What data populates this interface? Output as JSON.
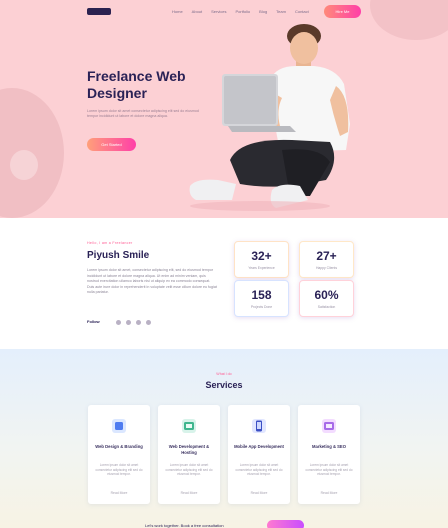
{
  "header": {
    "nav_items": [
      "Home",
      "About",
      "Services",
      "Portfolio",
      "Blog",
      "Team",
      "Contact"
    ],
    "hire_button": "Hire Me"
  },
  "hero": {
    "title": "Freelance Web Designer",
    "description": "Lorem ipsum dolor sit amet consectetur adipiscing elit sed do eiusmod tempor incididunt ut labore et dolore magna aliqua.",
    "button": "Get Started"
  },
  "about": {
    "kicker": "Hello, I am a Freelancer",
    "name": "Piyush Smile",
    "text": "Lorem ipsum dolor sit amet, consectetur adipiscing elit, sed do eiusmod tempor incididunt ut labore et dolore magna aliqua. Ut enim ad minim veniam, quis nostrud exercitation ullamco laboris nisi ut aliquip ex ea commodo consequat. Duis aute irure dolor in reprehenderit in voluptate velit esse cillum dolore eu fugiat nulla pariatur.",
    "signature": "Follow",
    "stats": [
      {
        "value": "32+",
        "label": "Years Experience"
      },
      {
        "value": "27+",
        "label": "Happy Clients"
      },
      {
        "value": "158",
        "label": "Projects Done"
      },
      {
        "value": "60%",
        "label": "Satisfaction"
      }
    ]
  },
  "services": {
    "kicker": "What I do",
    "title": "Services",
    "cards": [
      {
        "title": "Web Design & Branding",
        "text": "Lorem ipsum dolor sit amet consectetur adipiscing elit sed do eiusmod tempor.",
        "link": "Read More",
        "icon": "design-icon"
      },
      {
        "title": "Web Development & Hosting",
        "text": "Lorem ipsum dolor sit amet consectetur adipiscing elit sed do eiusmod tempor.",
        "link": "Read More",
        "icon": "code-icon"
      },
      {
        "title": "Mobile App Development",
        "text": "Lorem ipsum dolor sit amet consectetur adipiscing elit sed do eiusmod tempor.",
        "link": "Read More",
        "icon": "mobile-icon"
      },
      {
        "title": "Marketing & SEO",
        "text": "Lorem ipsum dolor sit amet consectetur adipiscing elit sed do eiusmod tempor.",
        "link": "Read More",
        "icon": "chart-icon"
      }
    ],
    "bottom_text": "Let's work together. Book a free consultation"
  },
  "colors": {
    "hero_bg": "#fcd0d4",
    "accent": "#ff3fa8",
    "heading": "#2a2256"
  }
}
